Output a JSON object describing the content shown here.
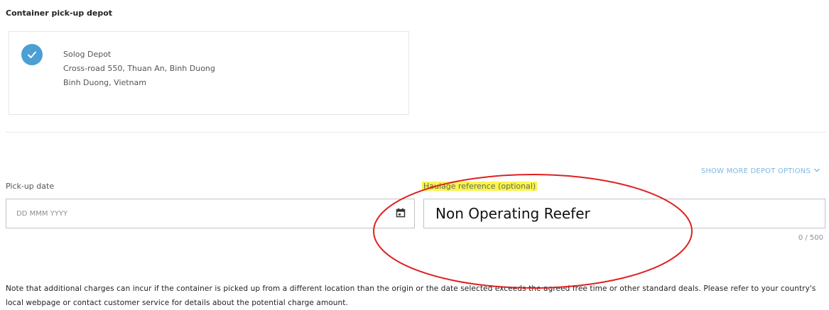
{
  "depot_section": {
    "title": "Container pick-up depot",
    "depot": {
      "name": "Solog Depot",
      "address_line": "Cross-road 550, Thuan An, Binh Duong",
      "region_line": "Binh Duong, Vietnam"
    },
    "more_options_label": "SHOW MORE DEPOT OPTIONS"
  },
  "pickup_date": {
    "label": "Pick-up date",
    "placeholder": "DD MMM YYYY"
  },
  "haulage_reference": {
    "label": "Haulage reference (optional)",
    "value": "Non Operating Reefer",
    "counter": "0 / 500"
  },
  "note": "Note that additional charges can incur if the container is picked up from a different location than the origin or the date selected exceeds the agreed free time or other standard deals. Please refer to your country's local webpage or contact customer service for details about the potential charge amount.",
  "colors": {
    "accent": "#4a9fd4",
    "link": "#7fb8de",
    "highlight": "#f8f54a",
    "annotation": "#e02020"
  }
}
